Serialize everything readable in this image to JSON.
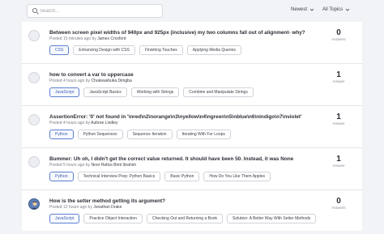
{
  "search": {
    "placeholder": "Search..."
  },
  "filters": {
    "sort": "Newest",
    "topics": "All Topics"
  },
  "questions": [
    {
      "title": "Between screen pixel widths of 940px and 925px (inclusive) my two columns fall out of alignment- why?",
      "posted": "Posted 15 minutes ago by",
      "author": "James Croxford",
      "answers": "0",
      "answers_label": "Answers",
      "tags": [
        "CSS",
        "Enhancing Design with CSS",
        "Finishing Touches",
        "Applying Media Queries"
      ]
    },
    {
      "title": "how to convert a var to uppercase",
      "posted": "Posted 4 hours ago by",
      "author": "Chukwuebuka Dimgba",
      "answers": "1",
      "answers_label": "Answer",
      "tags": [
        "JavaScript",
        "JavaScript Basics",
        "Working with Strings",
        "Combine and Manipulate Strings"
      ]
    },
    {
      "title": "AssertionError: '0' not found in '\\nred\\n2\\norange\\n3\\nyellow\\n4\\ngreen\\n5\\nblue\\n6\\nindigo\\n7\\nviolet'",
      "posted": "Posted 4 hours ago by",
      "author": "Aubree Lindley",
      "answers": "1",
      "answers_label": "Answer",
      "tags": [
        "Python",
        "Python Sequences",
        "Sequence Iteration",
        "Iterating With For Loops"
      ]
    },
    {
      "title": "Bummer: Uh oh, I didn't get the correct value returned. It should have been 50. Instead, it was None",
      "posted": "Posted 5 hours ago by",
      "author": "Noor Hafiza Binti Ibrahim",
      "answers": "1",
      "answers_label": "Answer",
      "tags": [
        "Python",
        "Technical Interview Prep: Python Basics",
        "Basic Python",
        "How Do You Like Them Apples"
      ]
    },
    {
      "title": "How is the setter method getting its argument?",
      "posted": "Posted 12 hours ago by",
      "author": "Jonathan Drake",
      "answers": "0",
      "answers_label": "Answers",
      "tags": [
        "JavaScript",
        "Practice Object Interaction",
        "Checking Out and Returning a Book",
        "Solution: A Better Way With Setter Methods"
      ]
    }
  ]
}
